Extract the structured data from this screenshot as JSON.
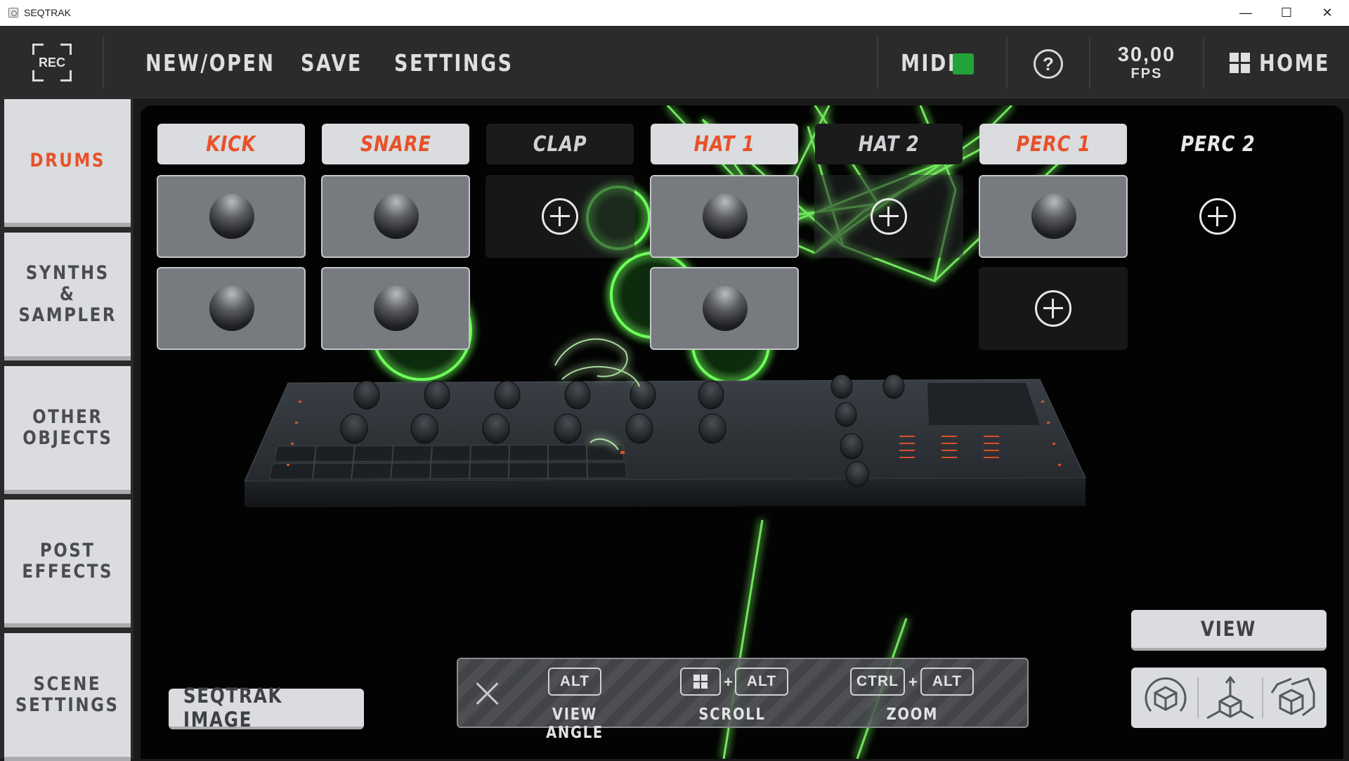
{
  "window": {
    "title": "SEQTRAK",
    "minimize": "—",
    "maximize": "☐",
    "close": "✕"
  },
  "appbar": {
    "rec_label": "REC",
    "menu": [
      "NEW/OPEN",
      "SAVE",
      "SETTINGS"
    ],
    "midi_label": "MIDI",
    "midi_status_color": "#22a33a",
    "help_label": "?",
    "fps_value": "30,00",
    "fps_label": "FPS",
    "home_label": "HOME"
  },
  "sidebar": {
    "items": [
      {
        "label": "DRUMS",
        "active": true
      },
      {
        "label": "SYNTHS\n&\nSAMPLER",
        "active": false
      },
      {
        "label": "OTHER\nOBJECTS",
        "active": false
      },
      {
        "label": "POST\nEFFECTS",
        "active": false
      },
      {
        "label": "SCENE\nSETTINGS",
        "active": false
      }
    ]
  },
  "tracks": [
    {
      "name": "KICK",
      "state": "active"
    },
    {
      "name": "SNARE",
      "state": "active"
    },
    {
      "name": "CLAP",
      "state": "dim"
    },
    {
      "name": "HAT 1",
      "state": "active"
    },
    {
      "name": "HAT 2",
      "state": "dim"
    },
    {
      "name": "PERC 1",
      "state": "active"
    },
    {
      "name": "PERC 2",
      "state": "none"
    }
  ],
  "viewport": {
    "image_button": "SEQTRAK IMAGE",
    "view_button": "VIEW",
    "hints": {
      "view_angle": {
        "keys": [
          "ALT"
        ],
        "label": "VIEW ANGLE"
      },
      "scroll": {
        "keys": [
          "ALT"
        ],
        "label": "SCROLL"
      },
      "zoom": {
        "keys": [
          "CTRL",
          "ALT"
        ],
        "label": "ZOOM"
      }
    },
    "camera_buttons": [
      "rotate-view-icon",
      "top-view-icon",
      "perspective-view-icon"
    ]
  },
  "colors": {
    "accent": "#e8512a",
    "laser": "#6dff5a",
    "panel": "#dadcdf"
  }
}
